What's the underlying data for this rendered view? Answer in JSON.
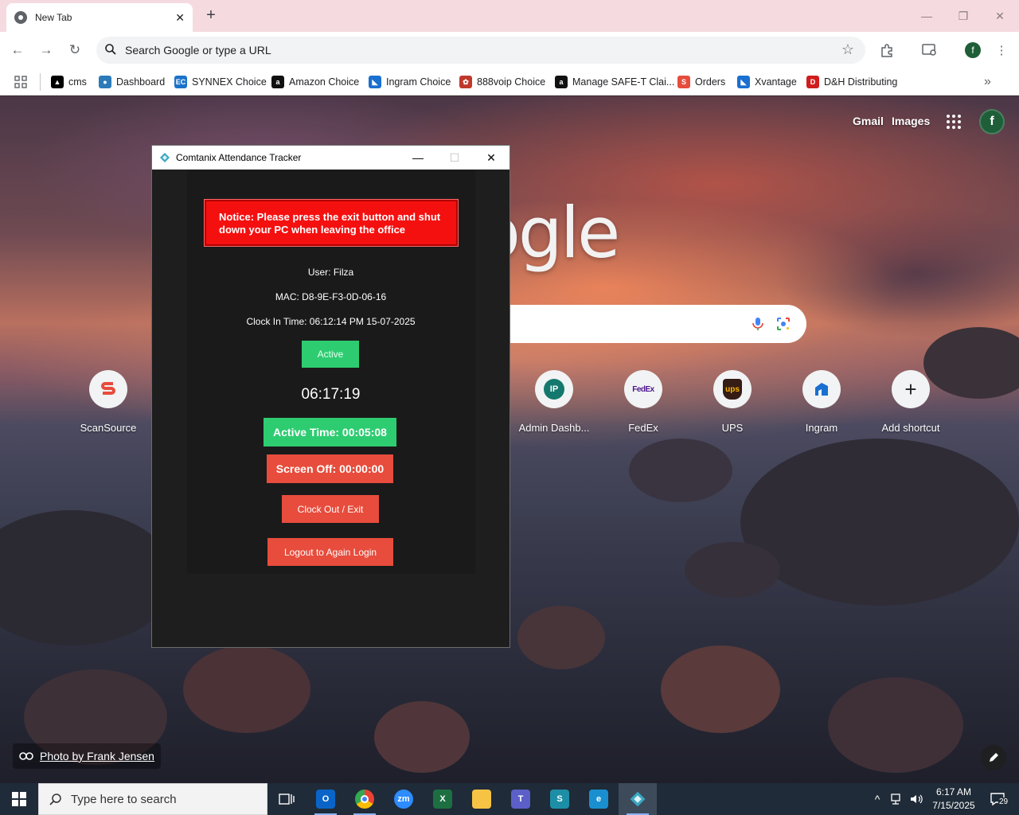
{
  "browser": {
    "tab_title": "New Tab",
    "omnibox_placeholder": "Search Google or type a URL",
    "profile_initial": "f"
  },
  "bookmarks": [
    {
      "label": "cms",
      "icon": "cms-icon",
      "color": "#000000"
    },
    {
      "label": "Dashboard",
      "icon": "dashboard-icon",
      "color": "#2b7bb9"
    },
    {
      "label": "SYNNEX Choice",
      "icon": "synnex-icon",
      "color": "#1a73c9"
    },
    {
      "label": "Amazon Choice",
      "icon": "amazon-icon",
      "color": "#111111"
    },
    {
      "label": "Ingram Choice",
      "icon": "ingram-icon",
      "color": "#1a6fd0"
    },
    {
      "label": "888voip Choice",
      "icon": "888voip-icon",
      "color": "#c0392b"
    },
    {
      "label": "Manage SAFE-T Clai...",
      "icon": "amazon-icon",
      "color": "#111111"
    },
    {
      "label": "Orders",
      "icon": "scansource-icon",
      "color": "#e74c3c"
    },
    {
      "label": "Xvantage",
      "icon": "ingram-icon",
      "color": "#1a6fd0"
    },
    {
      "label": "D&H Distributing",
      "icon": "dh-icon",
      "color": "#d01c1c"
    }
  ],
  "ntp": {
    "gmail": "Gmail",
    "images": "Images",
    "avatar_initial": "f",
    "logo_text": "ogle",
    "photo_credit": "Photo by Frank Jensen",
    "shortcuts": [
      {
        "label": "ScanSource",
        "icon": "scansource-icon"
      },
      {
        "label": "Admin Dashb...",
        "icon": "ip-icon",
        "badge": "IP"
      },
      {
        "label": "FedEx",
        "icon": "fedex-icon",
        "badge": "FedEx"
      },
      {
        "label": "UPS",
        "icon": "ups-icon",
        "badge": "ups"
      },
      {
        "label": "Ingram",
        "icon": "ingram-icon"
      },
      {
        "label": "Add shortcut",
        "icon": "plus-icon",
        "badge": "+"
      }
    ]
  },
  "tracker": {
    "window_title": "Comtanix Attendance Tracker",
    "notice_line1": "Notice: Please press the exit button and shut",
    "notice_line2": "down your PC when leaving the office",
    "user": "User: Filza",
    "mac": "MAC: D8-9E-F3-0D-06-16",
    "clock_in": "Clock In Time: 06:12:14 PM 15-07-2025",
    "status": "Active",
    "timer": "06:17:19",
    "active_time": "Active Time: 00:05:08",
    "screen_off": "Screen Off: 00:00:00",
    "clock_out": "Clock Out / Exit",
    "logout": "Logout to Again Login",
    "colors": {
      "green": "#2ecc71",
      "red": "#e74c3c",
      "notice": "#f51010"
    }
  },
  "taskbar": {
    "search_placeholder": "Type here to search",
    "time": "6:17 AM",
    "date": "7/15/2025",
    "notification_count": "29",
    "apps": [
      {
        "name": "task-view-icon"
      },
      {
        "name": "outlook-icon",
        "color": "#0a64c8",
        "glyph": "O"
      },
      {
        "name": "chrome-icon"
      },
      {
        "name": "zoom-icon",
        "color": "#2d8cff",
        "glyph": "zm"
      },
      {
        "name": "excel-icon",
        "color": "#1d6f42",
        "glyph": "X"
      },
      {
        "name": "file-explorer-icon",
        "color": "#f6c344",
        "glyph": ""
      },
      {
        "name": "teams-icon",
        "color": "#5b5fc7",
        "glyph": "T"
      },
      {
        "name": "app-s-icon",
        "color": "#1c8fa6",
        "glyph": "S"
      },
      {
        "name": "edge-icon",
        "color": "#1a8fd0",
        "glyph": "e"
      },
      {
        "name": "tracker-app-icon",
        "color": "#3aa6c2",
        "glyph": ""
      }
    ]
  }
}
